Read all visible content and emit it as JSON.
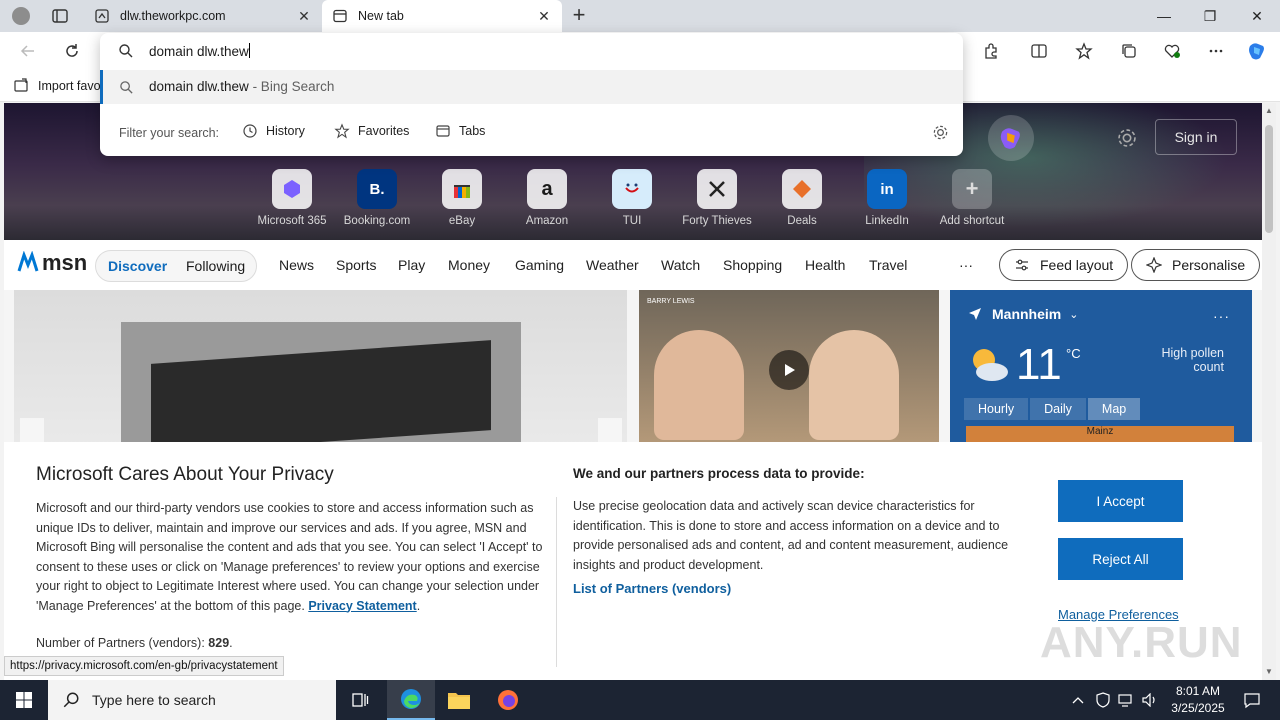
{
  "browser": {
    "tabs": [
      {
        "title": "dlw.theworkpc.com",
        "icon": "site-icon"
      },
      {
        "title": "New tab",
        "icon": "newtab-icon"
      }
    ],
    "favorites_bar": {
      "import_label": "Import favo"
    }
  },
  "omnibox": {
    "value": "domain dlw.thew",
    "suggestion_query": "domain dlw.thew",
    "suggestion_suffix": " - Bing Search",
    "filter_label": "Filter your search:",
    "filters": [
      "History",
      "Favorites",
      "Tabs"
    ]
  },
  "newtab": {
    "sign_in": "Sign in",
    "shortcuts": [
      {
        "label": "Microsoft 365",
        "glyph": ""
      },
      {
        "label": "Booking.com",
        "glyph": "B."
      },
      {
        "label": "eBay",
        "glyph": ""
      },
      {
        "label": "Amazon",
        "glyph": "a"
      },
      {
        "label": "TUI",
        "glyph": ""
      },
      {
        "label": "Forty Thieves",
        "glyph": ""
      },
      {
        "label": "Deals",
        "glyph": ""
      },
      {
        "label": "LinkedIn",
        "glyph": "in"
      },
      {
        "label": "Add shortcut",
        "glyph": "+"
      }
    ],
    "msn": {
      "logo": "msn",
      "pills": [
        "Discover",
        "Following"
      ],
      "nav": [
        "News",
        "Sports",
        "Play",
        "Money",
        "Gaming",
        "Weather",
        "Watch",
        "Shopping",
        "Health",
        "Travel"
      ],
      "more": "···",
      "feed_layout": "Feed layout",
      "personalise": "Personalise"
    },
    "weather": {
      "city": "Mannheim",
      "temp": "11",
      "unit": "°C",
      "pollen": "High pollen count",
      "tabs": [
        "Hourly",
        "Daily",
        "Map"
      ],
      "map_label": "Mainz",
      "more": "···"
    },
    "video_caption": "BARRY LEWIS"
  },
  "privacy": {
    "title": "Microsoft Cares About Your Privacy",
    "body": "Microsoft and our third-party vendors use cookies to store and access information such as unique IDs to deliver, maintain and improve our services and ads. If you agree, MSN and Microsoft Bing will personalise the content and ads that you see. You can select 'I Accept' to consent to these uses or click on 'Manage preferences' to review your options and exercise your right to object to Legitimate Interest where used.  You can change your selection under 'Manage Preferences' at the bottom of this page.",
    "privacy_link": "Privacy Statement",
    "partners_count_label": "Number of Partners (vendors):",
    "partners_count": "829",
    "right_title": "We and our partners process data to provide:",
    "right_body": "Use precise geolocation data and actively scan device characteristics for identification. This is done to store and access information on a device and to provide personalised ads and content, ad and content measurement, audience insights and product development.",
    "partners_link": "List of Partners (vendors)",
    "accept": "I Accept",
    "reject": "Reject All",
    "manage": "Manage Preferences"
  },
  "status_url": "https://privacy.microsoft.com/en-gb/privacystatement",
  "watermark": "ANY.RUN",
  "taskbar": {
    "search_placeholder": "Type here to search",
    "time": "8:01 AM",
    "date": "3/25/2025"
  }
}
